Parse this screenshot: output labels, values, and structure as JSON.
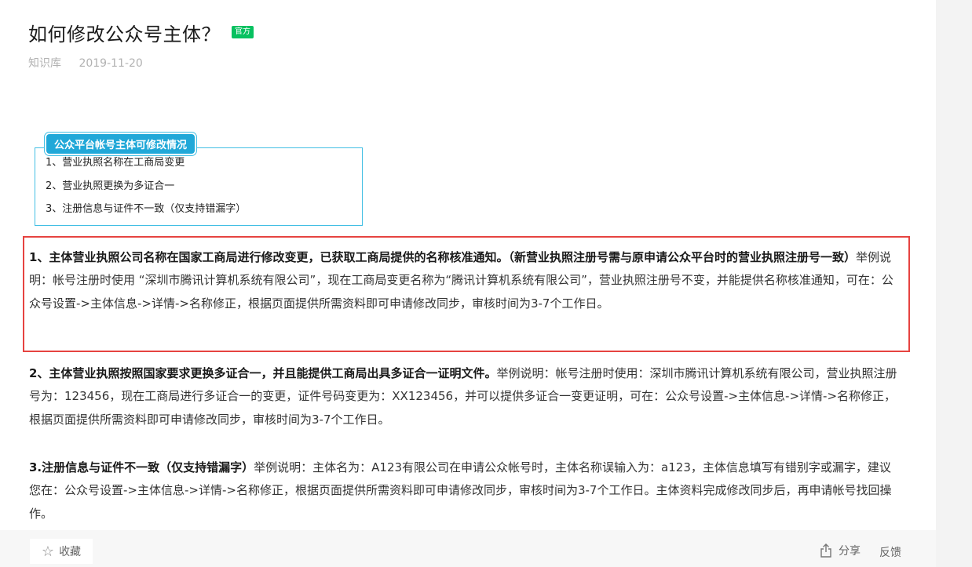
{
  "article": {
    "title": "如何修改公众号主体？",
    "badge": "官方",
    "source": "知识库",
    "date": "2019-11-20"
  },
  "capsule": {
    "header": "公众平台帐号主体可修改情况",
    "items": [
      "1、营业执照名称在工商局变更",
      "2、营业执照更换为多证合一",
      "3、注册信息与证件不一致（仅支持错漏字）"
    ]
  },
  "sections": [
    {
      "bold": "1、主体营业执照公司名称在国家工商局进行修改变更，已获取工商局提供的名称核准通知。（新营业执照注册号需与原申请公众平台时的营业执照注册号一致）",
      "text": "举例说明：帐号注册时使用 “深圳市腾讯计算机系统有限公司”，现在工商局变更名称为“腾讯计算机系统有限公司”，营业执照注册号不变，并能提供名称核准通知，可在：公众号设置->主体信息->详情->名称修正，根据页面提供所需资料即可申请修改同步，审核时间为3-7个工作日。"
    },
    {
      "bold": "2、主体营业执照按照国家要求更换多证合一，并且能提供工商局出具多证合一证明文件。",
      "text": "举例说明：帐号注册时使用：深圳市腾讯计算机系统有限公司，营业执照注册号为：123456，现在工商局进行多证合一的变更，证件号码变更为：XX123456，并可以提供多证合一变更证明，可在：公众号设置->主体信息->详情->名称修正，根据页面提供所需资料即可申请修改同步，审核时间为3-7个工作日。"
    },
    {
      "bold": "3.注册信息与证件不一致（仅支持错漏字）",
      "text": "举例说明：主体名为：A123有限公司在申请公众帐号时，主体名称误输入为：a123，主体信息填写有错别字或漏字，建议您在：公众号设置->主体信息->详情->名称修正，根据页面提供所需资料即可申请修改同步，审核时间为3-7个工作日。主体资料完成修改同步后，再申请帐号找回操作。"
    }
  ],
  "footer": {
    "favorite_label": "收藏",
    "share_label": "分享",
    "report_label": "反馈"
  },
  "colors": {
    "badge": "#07c160",
    "highlight_border": "#e64340",
    "capsule_blue": "#21a8d8"
  }
}
